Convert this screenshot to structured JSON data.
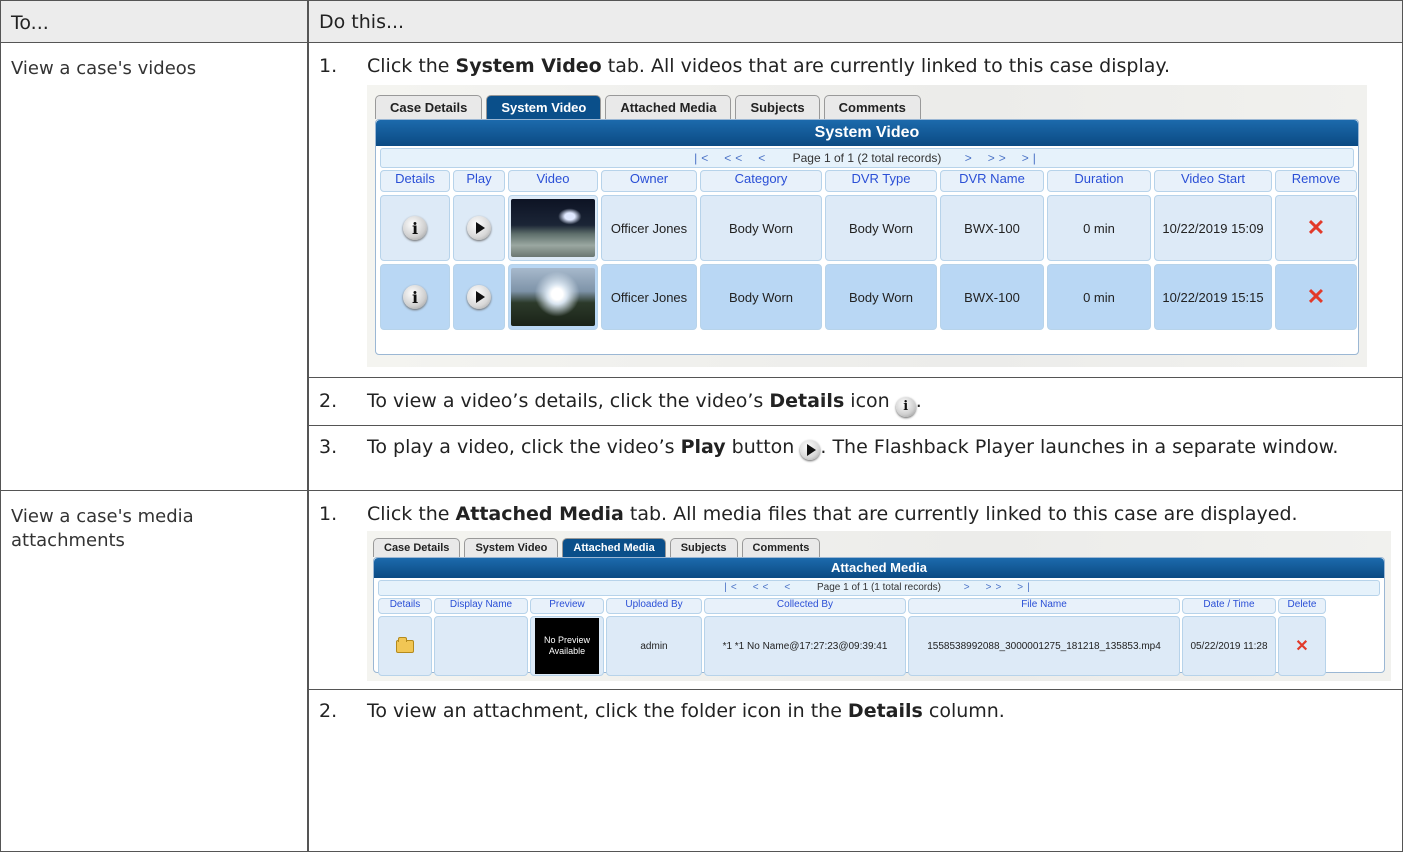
{
  "header": {
    "col_a": "To...",
    "col_b": "Do this..."
  },
  "row1": {
    "task": "View a case's videos",
    "steps": [
      {
        "num": "1.",
        "pre": "Click the ",
        "bold": "System Video",
        "post": " tab. All videos that are currently linked to this case display."
      },
      {
        "num": "2.",
        "pre": "To view a video’s details, click the video’s ",
        "bold": "Details",
        "post": " icon ",
        "end": "."
      },
      {
        "num": "3.",
        "pre": "To play a video, click the video’s ",
        "bold": "Play",
        "post": " button ",
        "end": ". The Flashback Player launches in a separate window."
      }
    ],
    "screenshot": {
      "tabs": [
        "Case Details",
        "System Video",
        "Attached Media",
        "Subjects",
        "Comments"
      ],
      "active_tab": "System Video",
      "panel_title": "System Video",
      "pager": {
        "first": "|<",
        "prev_prev": "<<",
        "prev": "<",
        "text": "Page 1 of 1 (2 total records)",
        "next": ">",
        "next_next": ">>",
        "last": ">|"
      },
      "columns": [
        "Details",
        "Play",
        "Video",
        "Owner",
        "Category",
        "DVR Type",
        "DVR Name",
        "Duration",
        "Video Start",
        "Remove"
      ],
      "rows": [
        {
          "owner": "Officer Jones",
          "category": "Body Worn",
          "dvr_type": "Body Worn",
          "dvr_name": "BWX-100",
          "duration": "0 min",
          "video_start": "10/22/2019 15:09"
        },
        {
          "owner": "Officer Jones",
          "category": "Body Worn",
          "dvr_type": "Body Worn",
          "dvr_name": "BWX-100",
          "duration": "0 min",
          "video_start": "10/22/2019 15:15"
        }
      ]
    }
  },
  "row2": {
    "task": "View a case's media attachments",
    "steps": [
      {
        "num": "1.",
        "pre": "Click the ",
        "bold": "Attached Media",
        "post": " tab. All media files that are currently linked to this case are displayed."
      },
      {
        "num": "2.",
        "pre": "To view an attachment, click the folder icon in the ",
        "bold": "Details",
        "post": " column."
      }
    ],
    "screenshot": {
      "tabs": [
        "Case Details",
        "System Video",
        "Attached Media",
        "Subjects",
        "Comments"
      ],
      "active_tab": "Attached Media",
      "panel_title": "Attached Media",
      "pager": {
        "first": "|<",
        "prev_prev": "<<",
        "prev": "<",
        "text": "Page 1 of 1 (1 total records)",
        "next": ">",
        "next_next": ">>",
        "last": ">|"
      },
      "columns": [
        "Details",
        "Display Name",
        "Preview",
        "Uploaded By",
        "Collected By",
        "File Name",
        "Date / Time",
        "Delete"
      ],
      "rows": [
        {
          "display_name": "",
          "preview": "No Preview Available",
          "uploaded_by": "admin",
          "collected_by": "*1 *1 No Name@17:27:23@09:39:41",
          "file_name": "1558538992088_3000001275_181218_135853.mp4",
          "date_time": "05/22/2019 11:28"
        }
      ]
    }
  }
}
